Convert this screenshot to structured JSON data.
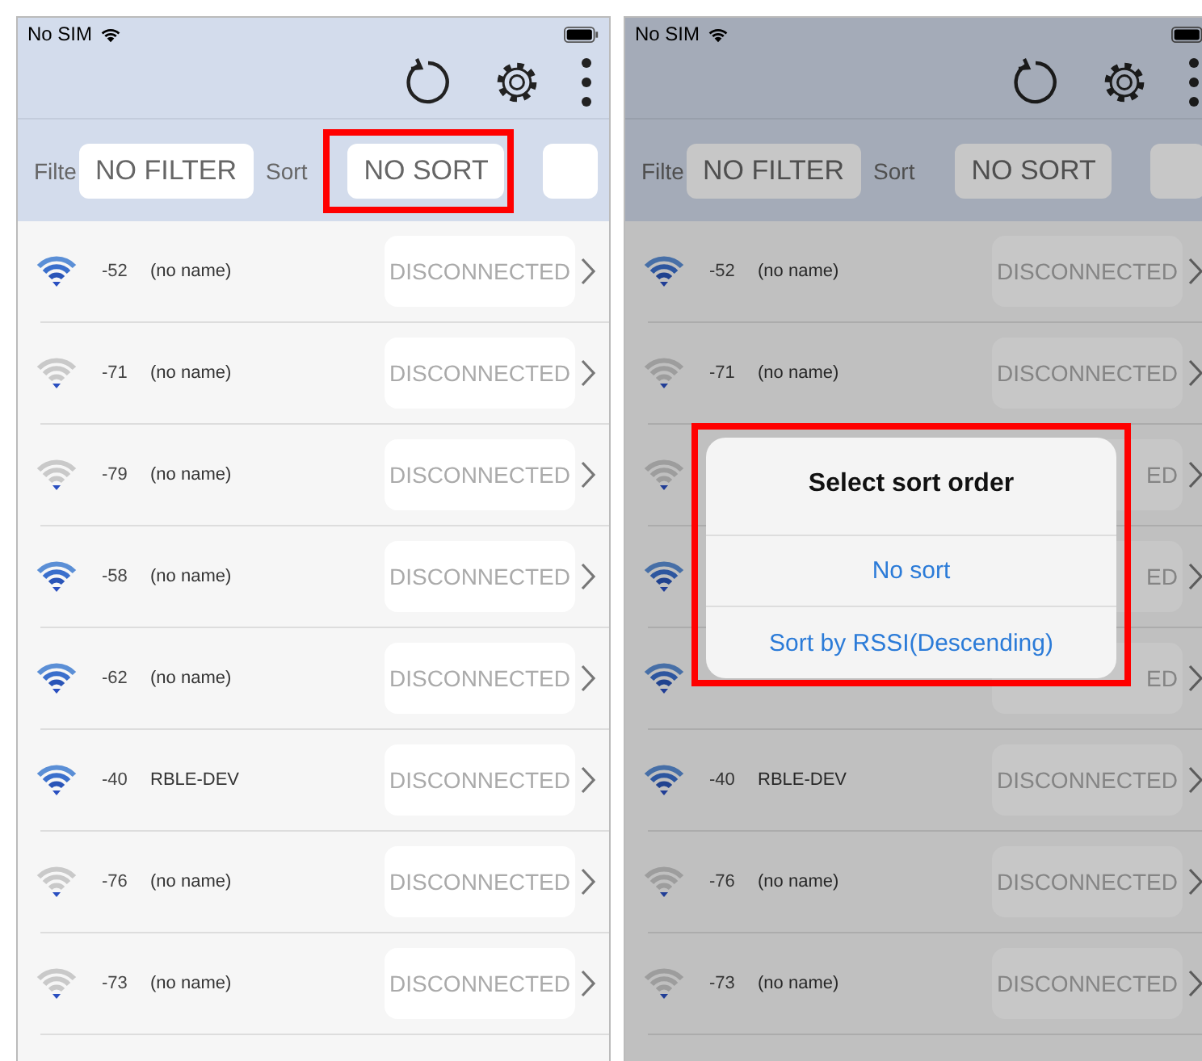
{
  "screens": [
    {
      "dimmed": false,
      "status_bar": {
        "carrier": "No SIM"
      },
      "filter": {
        "label": "Filte",
        "value": "NO FILTER"
      },
      "sort": {
        "label": "Sort",
        "value": "NO SORT",
        "highlighted": true
      },
      "devices": [
        {
          "rssi": "-52",
          "name": "(no name)",
          "strong_signal": true,
          "status": "DISCONNECTED"
        },
        {
          "rssi": "-71",
          "name": "(no name)",
          "strong_signal": false,
          "status": "DISCONNECTED"
        },
        {
          "rssi": "-79",
          "name": "(no name)",
          "strong_signal": false,
          "status": "DISCONNECTED"
        },
        {
          "rssi": "-58",
          "name": "(no name)",
          "strong_signal": true,
          "status": "DISCONNECTED"
        },
        {
          "rssi": "-62",
          "name": "(no name)",
          "strong_signal": true,
          "status": "DISCONNECTED"
        },
        {
          "rssi": "-40",
          "name": "RBLE-DEV",
          "strong_signal": true,
          "status": "DISCONNECTED"
        },
        {
          "rssi": "-76",
          "name": "(no name)",
          "strong_signal": false,
          "status": "DISCONNECTED"
        },
        {
          "rssi": "-73",
          "name": "(no name)",
          "strong_signal": false,
          "status": "DISCONNECTED"
        }
      ]
    },
    {
      "dimmed": true,
      "status_bar": {
        "carrier": "No SIM"
      },
      "filter": {
        "label": "Filte",
        "value": "NO FILTER"
      },
      "sort": {
        "label": "Sort",
        "value": "NO SORT"
      },
      "devices": [
        {
          "rssi": "-52",
          "name": "(no name)",
          "strong_signal": true,
          "status": "DISCONNECTED"
        },
        {
          "rssi": "-71",
          "name": "(no name)",
          "strong_signal": false,
          "status": "DISCONNECTED"
        },
        {
          "strong_signal": false,
          "status": "ED"
        },
        {
          "strong_signal": true,
          "status": "ED"
        },
        {
          "strong_signal": true,
          "status": "ED"
        },
        {
          "rssi": "-40",
          "name": "RBLE-DEV",
          "strong_signal": true,
          "status": "DISCONNECTED"
        },
        {
          "rssi": "-76",
          "name": "(no name)",
          "strong_signal": false,
          "status": "DISCONNECTED"
        },
        {
          "rssi": "-73",
          "name": "(no name)",
          "strong_signal": false,
          "status": "DISCONNECTED"
        }
      ],
      "alert": {
        "title": "Select sort order",
        "actions": [
          "No sort",
          "Sort by RSSI(Descending)"
        ],
        "highlighted": true
      }
    }
  ]
}
